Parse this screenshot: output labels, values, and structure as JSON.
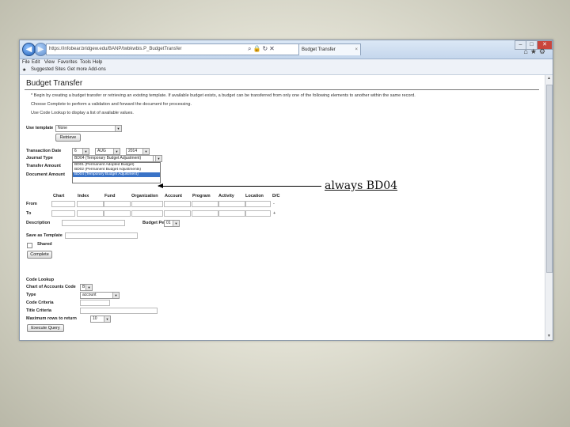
{
  "browser": {
    "address": "https://infobear.bridgew.edu/BANP/twbkwbis.P_BudgetTransfer",
    "tab_title": "Budget Transfer",
    "tab_close": "×",
    "window_controls": [
      "–",
      "□",
      "✕"
    ],
    "menu": [
      "File",
      "Edit",
      "View",
      "Favorites",
      "Tools",
      "Help"
    ],
    "favorites": [
      "Suggested Sites",
      "Get more Add-ons"
    ],
    "icons": [
      "back-icon",
      "forward-icon",
      "home-icon",
      "star-icon",
      "gear-icon"
    ]
  },
  "page": {
    "title": "Budget Transfer",
    "instructions": [
      "* Begin by creating a budget transfer or retrieving an existing template. If available budget exists, a budget can be transferred from only one of the following elements to another within the same record.",
      "Choose Complete to perform a validation and forward the document for processing.",
      "Use Code Lookup to display a list of available values."
    ],
    "use_template": {
      "label": "Use template",
      "value": "None",
      "button": "Retrieve"
    },
    "transaction_date": {
      "label": "Transaction Date",
      "day": "6",
      "month": "AUG",
      "year": "2014"
    },
    "journal_type": {
      "label": "Journal Type",
      "value": "BD04 (Temporary Budget Adjustment)"
    },
    "transfer_amount": {
      "label": "Transfer Amount"
    },
    "document_amount": {
      "label": "Document Amount"
    },
    "journal_options": [
      "BD01 (Permanent Adopted Budget)",
      "BD02 (Permanent Budget Adjustments)",
      "BD04 (Temporary Budget Adjustment)"
    ],
    "columns": [
      "Chart",
      "Index",
      "Fund",
      "Organization",
      "Account",
      "Program",
      "Activity",
      "Location",
      "D/C"
    ],
    "rows": [
      {
        "label": "From",
        "dc": "-"
      },
      {
        "label": "To",
        "dc": "+"
      }
    ],
    "description": {
      "label": "Description"
    },
    "budget_period": {
      "label": "Budget Period",
      "value": "01"
    },
    "save_template": {
      "label": "Save as Template",
      "shared": "Shared",
      "button": "Complete"
    },
    "code_lookup": {
      "title": "Code Lookup",
      "chart_label": "Chart of Accounts Code",
      "chart_value": "B",
      "type_label": "Type",
      "type_value": "account",
      "criteria_label": "Code Criteria",
      "title_criteria_label": "Title Criteria",
      "max_rows_label": "Maximum rows to return",
      "max_rows_value": "10",
      "button": "Execute Query"
    }
  },
  "annotation": "always BD04"
}
